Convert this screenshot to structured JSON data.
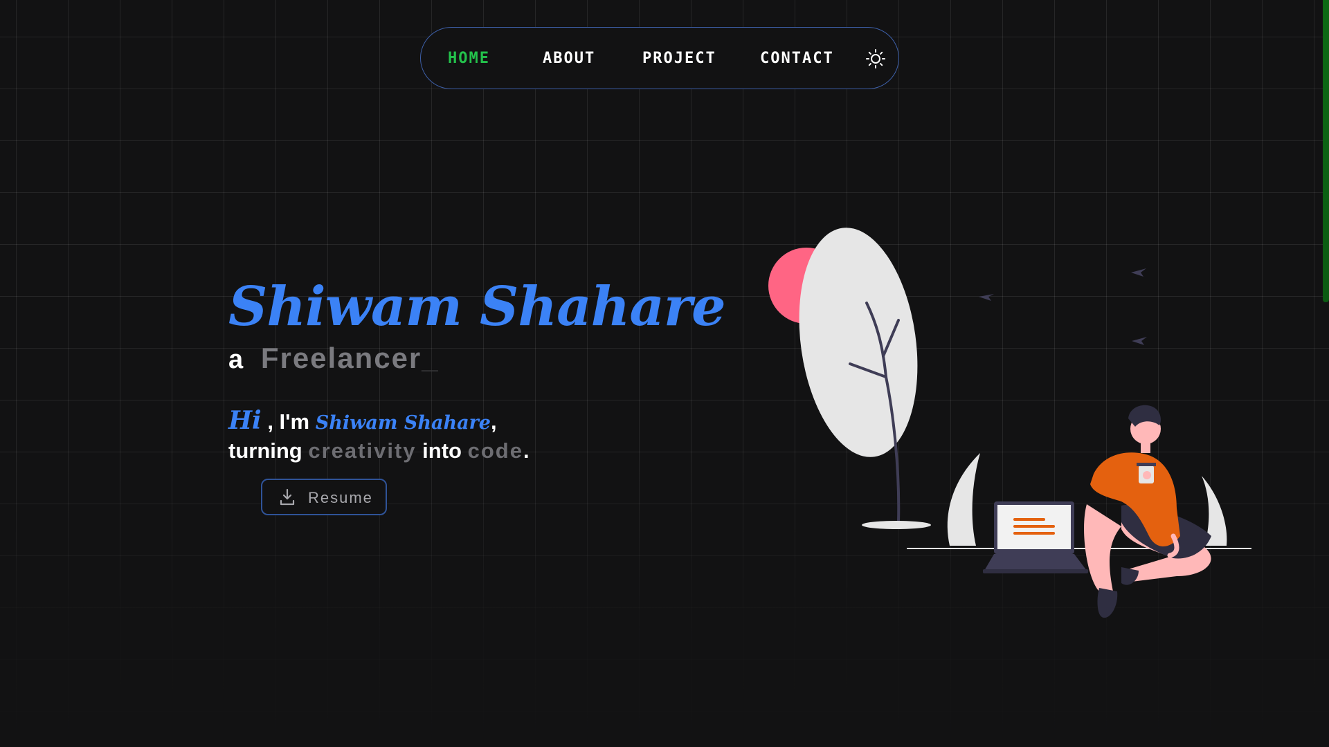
{
  "nav": {
    "items": [
      {
        "label": "HOME",
        "active": true
      },
      {
        "label": "ABOUT",
        "active": false
      },
      {
        "label": "PROJECT",
        "active": false
      },
      {
        "label": "CONTACT",
        "active": false
      }
    ],
    "theme_icon": "sun-icon"
  },
  "hero": {
    "name": "Shiwam Shahare",
    "tagline_prefix": "a",
    "tagline_role": "Freelancer",
    "tagline_cursor": "_",
    "intro_hi": "Hi",
    "intro_im": ", I'm",
    "intro_name": "Shiwam Shahare",
    "intro_comma": ",",
    "intro_turning": "turning",
    "intro_creativity": "creativity",
    "intro_into": "into",
    "intro_code": "code",
    "intro_period": ".",
    "resume_label": "Resume",
    "resume_icon": "download-icon"
  },
  "colors": {
    "accent_blue": "#3b82f6",
    "active_green": "#23c14b",
    "background": "#121213",
    "nav_border": "#3d5fa8",
    "person_shirt": "#e4610f"
  }
}
